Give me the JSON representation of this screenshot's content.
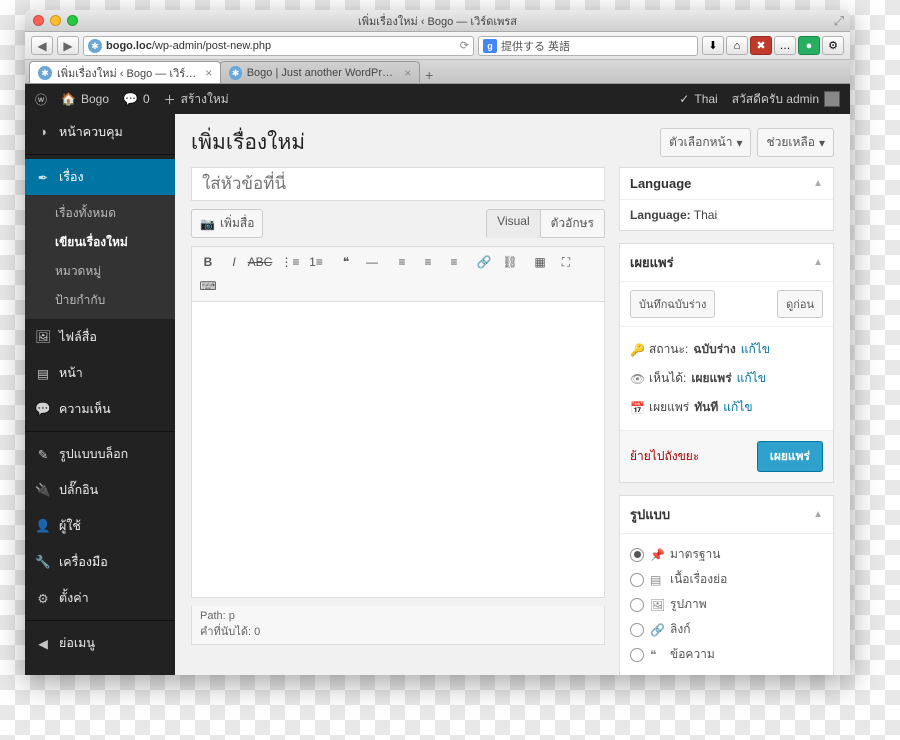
{
  "browser": {
    "title": "เพิ่มเรื่องใหม่ ‹ Bogo — เวิร์ดเพรส",
    "url_host": "bogo.loc",
    "url_path": "/wp-admin/post-new.php",
    "search_hint": "提供する 英語",
    "tabs": [
      {
        "label": "เพิ่มเรื่องใหม่ ‹ Bogo — เวิร์…",
        "active": true
      },
      {
        "label": "Bogo | Just another WordPress …",
        "active": false
      }
    ]
  },
  "adminbar": {
    "site": "Bogo",
    "comment_count": "0",
    "new": "สร้างใหม่",
    "lang_check": "Thai",
    "greeting": "สวัสดีครับ admin"
  },
  "menu": {
    "items": [
      {
        "icon": "◑",
        "label": "หน้าควบคุม"
      },
      {
        "icon": "✒",
        "label": "เรื่อง",
        "active": true,
        "sub": [
          {
            "label": "เรื่องทั้งหมด"
          },
          {
            "label": "เขียนเรื่องใหม่",
            "current": true
          },
          {
            "label": "หมวดหมู่"
          },
          {
            "label": "ป้ายกำกับ"
          }
        ]
      },
      {
        "icon": "🖼",
        "label": "ไฟล์สื่อ"
      },
      {
        "icon": "▤",
        "label": "หน้า"
      },
      {
        "icon": "💬",
        "label": "ความเห็น"
      },
      {
        "sep": true
      },
      {
        "icon": "✎",
        "label": "รูปแบบบล็อก"
      },
      {
        "icon": "🔌",
        "label": "ปลั๊กอิน"
      },
      {
        "icon": "👤",
        "label": "ผู้ใช้"
      },
      {
        "icon": "🔧",
        "label": "เครื่องมือ"
      },
      {
        "icon": "⚙",
        "label": "ตั้งค่า"
      },
      {
        "sep": true
      },
      {
        "icon": "◀",
        "label": "ย่อเมนู"
      }
    ]
  },
  "page": {
    "heading": "เพิ่มเรื่องใหม่",
    "screen_options": "ตัวเลือกหน้า",
    "help": "ช่วยเหลือ",
    "title_placeholder": "ใส่หัวข้อที่นี่",
    "add_media": "เพิ่มสื่อ",
    "tab_visual": "Visual",
    "tab_text": "ตัวอักษร",
    "path_label": "Path: p",
    "wordcount_label": "คำที่นับได้: 0"
  },
  "box_lang": {
    "title": "Language",
    "row_label": "Language:",
    "row_value": "Thai"
  },
  "box_publish": {
    "title": "เผยแพร่",
    "save_draft": "บันทึกฉบับร่าง",
    "preview": "ดูก่อน",
    "status_label": "สถานะ:",
    "status_value": "ฉบับร่าง",
    "visibility_label": "เห็นได้:",
    "visibility_value": "เผยแพร่",
    "sched_label": "เผยแพร่",
    "sched_value": "ทันที",
    "edit_link": "แก้ไข",
    "trash": "ย้ายไปถังขยะ",
    "publish_btn": "เผยแพร่"
  },
  "box_format": {
    "title": "รูปแบบ",
    "items": [
      {
        "icon": "📌",
        "label": "มาตรฐาน",
        "selected": true
      },
      {
        "icon": "▤",
        "label": "เนื้อเรื่องย่อ"
      },
      {
        "icon": "🖼",
        "label": "รูปภาพ"
      },
      {
        "icon": "🔗",
        "label": "ลิงก์"
      },
      {
        "icon": "❝",
        "label": "ข้อความ"
      }
    ]
  }
}
